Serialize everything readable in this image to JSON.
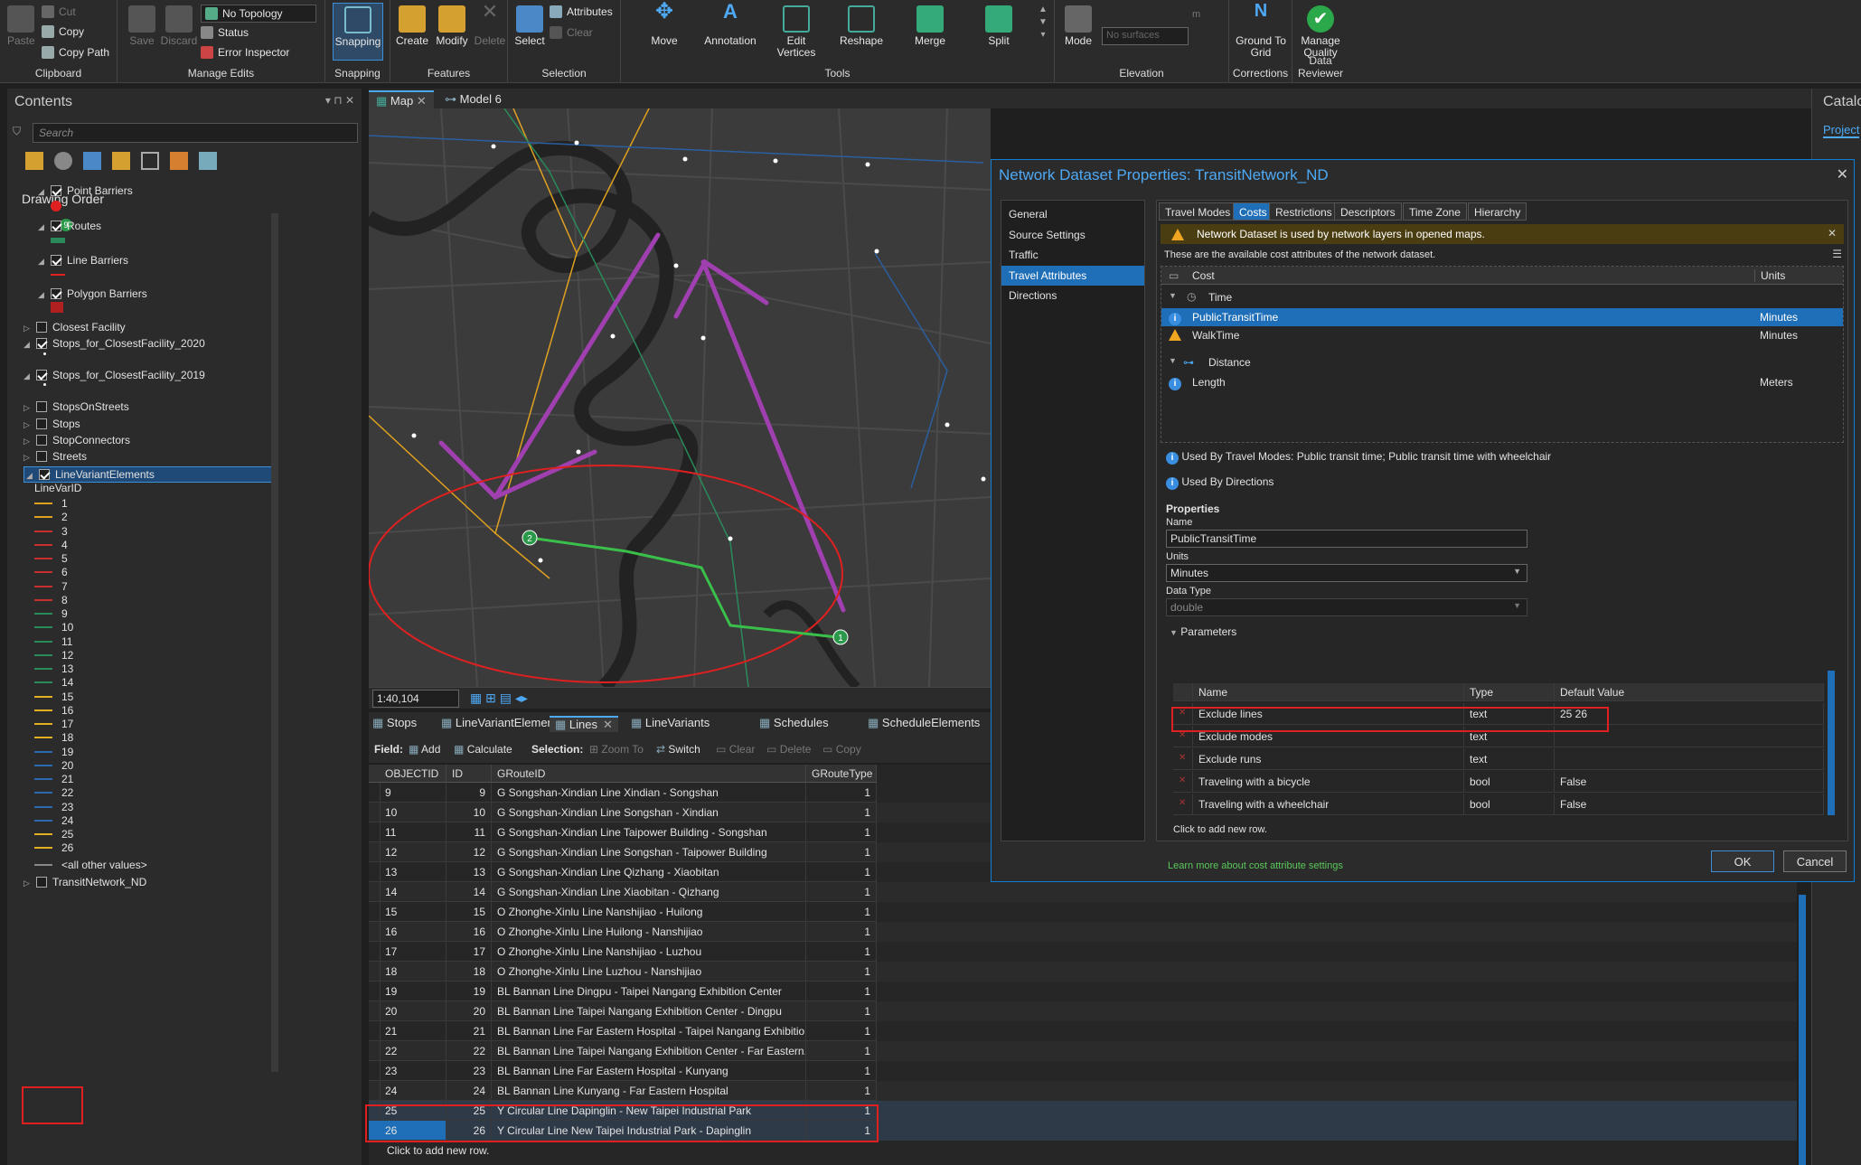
{
  "ribbon": {
    "clipboard": {
      "paste": "Paste",
      "cut": "Cut",
      "copy": "Copy",
      "copy_path": "Copy Path",
      "group": "Clipboard"
    },
    "manage_edits": {
      "save": "Save",
      "discard": "Discard",
      "topology": "No Topology",
      "status": "Status",
      "error_inspector": "Error Inspector",
      "group": "Manage Edits"
    },
    "snapping": {
      "label": "Snapping",
      "group": "Snapping"
    },
    "features": {
      "create": "Create",
      "modify": "Modify",
      "delete": "Delete",
      "group": "Features"
    },
    "selection": {
      "select": "Select",
      "attributes": "Attributes",
      "clear": "Clear",
      "group": "Selection"
    },
    "tools": {
      "move": "Move",
      "annotation": "Annotation",
      "edit_vertices": "Edit Vertices",
      "reshape": "Reshape",
      "merge": "Merge",
      "split": "Split",
      "group": "Tools"
    },
    "elevation": {
      "mode": "Mode",
      "surface": "No surfaces",
      "unit": "m",
      "group": "Elevation"
    },
    "corrections": {
      "ground_to_grid": "Ground To Grid",
      "group": "Corrections"
    },
    "data_reviewer": {
      "manage_quality": "Manage Quality",
      "group": "Data Reviewer"
    }
  },
  "contents": {
    "title": "Contents",
    "search_placeholder": "Search",
    "drawing_order": "Drawing Order",
    "layers": [
      {
        "label": "Point Barriers",
        "checked": true
      },
      {
        "label": "Routes",
        "checked": true
      },
      {
        "label": "Line Barriers",
        "checked": true
      },
      {
        "label": "Polygon Barriers",
        "checked": true
      },
      {
        "label": "Closest Facility",
        "checked": false
      },
      {
        "label": "Stops_for_ClosestFacility_2020",
        "checked": true
      },
      {
        "label": "Stops_for_ClosestFacility_2019",
        "checked": true
      },
      {
        "label": "StopsOnStreets",
        "checked": false
      },
      {
        "label": "Stops",
        "checked": false
      },
      {
        "label": "StopConnectors",
        "checked": false
      },
      {
        "label": "Streets",
        "checked": false
      },
      {
        "label": "LineVariantElements",
        "checked": true
      },
      {
        "label": "TransitNetwork_ND",
        "checked": false
      }
    ],
    "legend_field": "LineVarID",
    "legend_values": [
      "1",
      "2",
      "3",
      "4",
      "5",
      "6",
      "7",
      "8",
      "9",
      "10",
      "11",
      "12",
      "13",
      "14",
      "15",
      "16",
      "17",
      "18",
      "19",
      "20",
      "21",
      "22",
      "23",
      "24",
      "25",
      "26"
    ],
    "legend_colors": [
      "#e0a020",
      "#e0a020",
      "#c83030",
      "#c83030",
      "#c83030",
      "#c83030",
      "#c83030",
      "#c83030",
      "#2a8a5a",
      "#2a8a5a",
      "#2a8a5a",
      "#2a8a5a",
      "#2a8a5a",
      "#2a8a5a",
      "#e0b020",
      "#e0b020",
      "#e0b020",
      "#e0b020",
      "#2a6ab0",
      "#2a6ab0",
      "#2a6ab0",
      "#2a6ab0",
      "#2a6ab0",
      "#2a6ab0",
      "#e0b020",
      "#e0b020"
    ],
    "other_values": "<all other values>",
    "stop_label": "9"
  },
  "map": {
    "tabs": [
      "Map",
      "Model 6"
    ],
    "scale": "1:40,104",
    "stop1": "1",
    "stop2": "2"
  },
  "table_tabs": [
    "Stops",
    "LineVariantElements",
    "Lines",
    "LineVariants",
    "Schedules",
    "ScheduleElements"
  ],
  "table_toolbar": {
    "field": "Field:",
    "add": "Add",
    "calculate": "Calculate",
    "selection": "Selection:",
    "zoom_to": "Zoom To",
    "switch": "Switch",
    "clear": "Clear",
    "delete": "Delete",
    "copy": "Copy"
  },
  "grid": {
    "headers": [
      "OBJECTID",
      "ID",
      "GRouteID",
      "GRouteType"
    ],
    "rows": [
      [
        "9",
        "9",
        "G Songshan-Xindian Line Xindian - Songshan",
        "1"
      ],
      [
        "10",
        "10",
        "G Songshan-Xindian Line Songshan - Xindian",
        "1"
      ],
      [
        "11",
        "11",
        "G Songshan-Xindian Line Taipower Building - Songshan",
        "1"
      ],
      [
        "12",
        "12",
        "G Songshan-Xindian Line Songshan - Taipower Building",
        "1"
      ],
      [
        "13",
        "13",
        "G Songshan-Xindian Line Qizhang - Xiaobitan",
        "1"
      ],
      [
        "14",
        "14",
        "G Songshan-Xindian Line Xiaobitan - Qizhang",
        "1"
      ],
      [
        "15",
        "15",
        "O Zhonghe-Xinlu Line Nanshijiao - Huilong",
        "1"
      ],
      [
        "16",
        "16",
        "O Zhonghe-Xinlu Line Huilong - Nanshijiao",
        "1"
      ],
      [
        "17",
        "17",
        "O Zhonghe-Xinlu Line Nanshijiao - Luzhou",
        "1"
      ],
      [
        "18",
        "18",
        "O Zhonghe-Xinlu Line Luzhou - Nanshijiao",
        "1"
      ],
      [
        "19",
        "19",
        "BL Bannan Line Dingpu - Taipei Nangang Exhibition Center",
        "1"
      ],
      [
        "20",
        "20",
        "BL Bannan Line Taipei Nangang Exhibition Center - Dingpu",
        "1"
      ],
      [
        "21",
        "21",
        "BL Bannan Line Far Eastern Hospital - Taipei Nangang Exhibition...",
        "1"
      ],
      [
        "22",
        "22",
        "BL Bannan Line Taipei Nangang Exhibition Center - Far Eastern...",
        "1"
      ],
      [
        "23",
        "23",
        "BL Bannan Line Far Eastern Hospital - Kunyang",
        "1"
      ],
      [
        "24",
        "24",
        "BL Bannan Line Kunyang - Far Eastern Hospital",
        "1"
      ],
      [
        "25",
        "25",
        "Y Circular Line Dapinglin - New Taipei Industrial Park",
        "1"
      ],
      [
        "26",
        "26",
        "Y Circular Line New Taipei Industrial Park - Dapinglin",
        "1"
      ]
    ],
    "add_row": "Click to add new row."
  },
  "dialog": {
    "title": "Network Dataset Properties: TransitNetwork_ND",
    "nav": [
      "General",
      "Source Settings",
      "Traffic",
      "Travel Attributes",
      "Directions"
    ],
    "tabs": [
      "Travel Modes",
      "Costs",
      "Restrictions",
      "Descriptors",
      "Time Zone",
      "Hierarchy"
    ],
    "warning": "Network Dataset is used by network layers in opened maps.",
    "intro": "These are the available cost attributes of the network dataset.",
    "cost_header": "Cost",
    "units_header": "Units",
    "group_time": "Time",
    "group_distance": "Distance",
    "costs": [
      {
        "name": "PublicTransitTime",
        "units": "Minutes"
      },
      {
        "name": "WalkTime",
        "units": "Minutes"
      },
      {
        "name": "Length",
        "units": "Meters"
      }
    ],
    "used_by_modes": "Used By Travel Modes: Public transit time; Public transit time with wheelchair",
    "used_by_directions": "Used By Directions",
    "properties": "Properties",
    "name_label": "Name",
    "name_value": "PublicTransitTime",
    "units_label": "Units",
    "units_value": "Minutes",
    "datatype_label": "Data Type",
    "datatype_value": "double",
    "parameters": "Parameters",
    "param_headers": [
      "Name",
      "Type",
      "Default Value"
    ],
    "params": [
      [
        "Exclude lines",
        "text",
        "25 26"
      ],
      [
        "Exclude modes",
        "text",
        ""
      ],
      [
        "Exclude runs",
        "text",
        ""
      ],
      [
        "Traveling with a bicycle",
        "bool",
        "False"
      ],
      [
        "Traveling with a wheelchair",
        "bool",
        "False"
      ]
    ],
    "add_row": "Click to add new row.",
    "learn_more": "Learn more about cost attribute settings",
    "ok": "OK",
    "cancel": "Cancel"
  },
  "catalog": {
    "title": "Catalo",
    "project": "Project"
  }
}
